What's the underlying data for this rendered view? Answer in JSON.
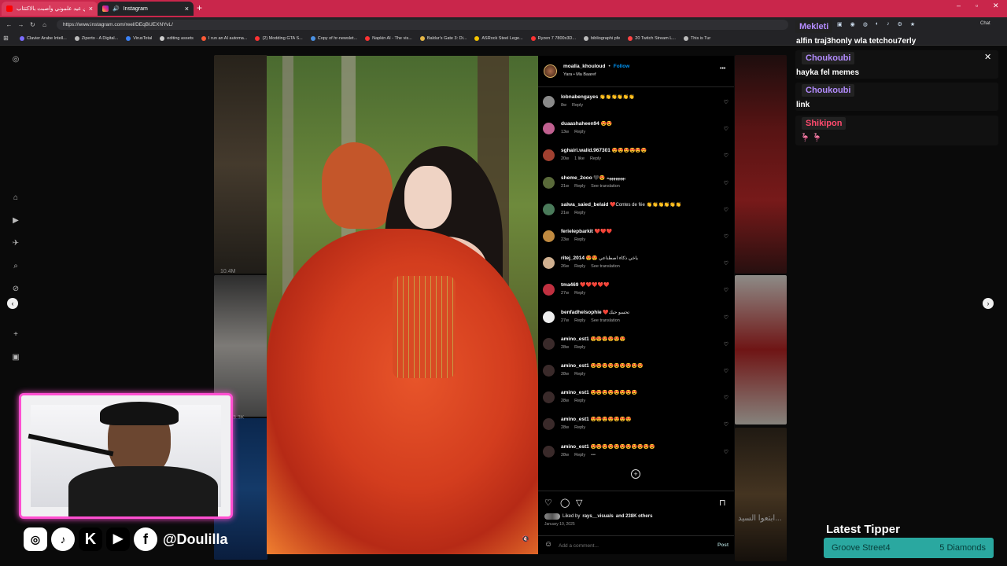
{
  "browser": {
    "tabs": [
      {
        "title": "ذي عيد علموني وأصبت بالاكتئاب",
        "active": false
      },
      {
        "title": "Instagram",
        "active": true
      }
    ],
    "url": "https://www.instagram.com/reel/DEqBUEXNYvL/",
    "bookmarks": [
      "Clavier Arabe Intell...",
      "Ziperto - A Digital...",
      "VirusTotal",
      "editing assets",
      "I run an AI automa...",
      "(2) Modding GTA S...",
      "Copy of hr-newslet...",
      "Napkin AI - The vis...",
      "Baldur's Gate 3: Di...",
      "ASRock Steel Lege...",
      "Ryzen 7 7800x3D...",
      "bibliographi pfe",
      "20 Twitch Stream L...",
      "This is Tur"
    ],
    "chat_label": "Chat"
  },
  "page": {
    "bg_views": "10.4M",
    "bg_count2": "3.3K",
    "bg_overlay": "ابتعوا السيد..."
  },
  "post": {
    "username": "moalla_khouloud",
    "follow": "Follow",
    "audio": "Yara • Ma Baaref",
    "more": "•••",
    "comments": [
      {
        "user": "lobnabengayes",
        "text": "👏👏👏👏👏👏",
        "time": "8w",
        "extra": "",
        "reply": "Reply",
        "translate": ""
      },
      {
        "user": "duaashaheen94",
        "text": "😍😍",
        "time": "13w",
        "extra": "",
        "reply": "Reply",
        "translate": ""
      },
      {
        "user": "sghairi.walid.967301",
        "text": "😍😍😍😍😍😍",
        "time": "20w",
        "extra": "1 like",
        "reply": "Reply",
        "translate": ""
      },
      {
        "user": "sheme_2ooo",
        "text": "🖤😍 يهههههههه",
        "time": "21w",
        "extra": "",
        "reply": "Reply",
        "translate": "See translation"
      },
      {
        "user": "salwa_saied_belaid",
        "text": "❤️Contes de fée 👏👏👏👏👏👏",
        "time": "21w",
        "extra": "",
        "reply": "Reply",
        "translate": ""
      },
      {
        "user": "ferielepbarkit",
        "text": "❤️❤️❤️",
        "time": "23w",
        "extra": "",
        "reply": "Reply",
        "translate": ""
      },
      {
        "user": "ritej_2014",
        "text": "😍😍 ياخي ذكاء اصطناعي",
        "time": "26w",
        "extra": "",
        "reply": "Reply",
        "translate": "See translation"
      },
      {
        "user": "tma469",
        "text": "❤️❤️❤️❤️❤️",
        "time": "27w",
        "extra": "",
        "reply": "Reply",
        "translate": ""
      },
      {
        "user": "benfadhelsophie",
        "text": "❤️تحسو حبك",
        "time": "27w",
        "extra": "",
        "reply": "Reply",
        "translate": "See translation"
      },
      {
        "user": "amino_est1",
        "text": "😍😍😍😍😍😍",
        "time": "28w",
        "extra": "",
        "reply": "Reply",
        "translate": ""
      },
      {
        "user": "amino_est1",
        "text": "😍😍😍😍😍😍😍😍😍",
        "time": "28w",
        "extra": "",
        "reply": "Reply",
        "translate": ""
      },
      {
        "user": "amino_est1",
        "text": "😍😍😍😍😍😍😍😍",
        "time": "28w",
        "extra": "",
        "reply": "Reply",
        "translate": ""
      },
      {
        "user": "amino_est1",
        "text": "😍😍😍😍😍😍😍",
        "time": "28w",
        "extra": "",
        "reply": "Reply",
        "translate": ""
      },
      {
        "user": "amino_est1",
        "text": "😍😍😍😍😍😍😍😍😍😍😍",
        "time": "28w",
        "extra": "",
        "reply": "Reply",
        "translate": "•••"
      }
    ],
    "liked_by": "Liked by",
    "liked_user": "rays__visuals",
    "liked_rest": "and 238K others",
    "date": "January 10, 2025",
    "add_comment_placeholder": "Add a comment...",
    "post_button": "Post"
  },
  "chat": {
    "messages": [
      {
        "user": "Mekleti",
        "text": "alfin traj3honly wla tetchou7erly",
        "color": "#b48cff"
      },
      {
        "user": "Choukoubi",
        "text": "hayka fel memes",
        "color": "#b48cff"
      },
      {
        "user": "Choukoubi",
        "text": "link",
        "color": "#b48cff"
      },
      {
        "user": "Shikipon",
        "text": "",
        "color": "#ff4a6e"
      }
    ]
  },
  "overlay": {
    "handle": "@Doulilla",
    "latest_tipper_title": "Latest Tipper",
    "tipper_name": "Groove Street4",
    "tipper_amount": "5 Diamonds",
    "social_icons": [
      "instagram-icon",
      "tiktok-icon",
      "kick-icon",
      "youtube-icon",
      "facebook-icon"
    ]
  },
  "colors": {
    "tabbar": "#c9264b",
    "cam_border": "#ff4fd1",
    "follow": "#0095f6",
    "tipper": "#2aa8a0"
  }
}
